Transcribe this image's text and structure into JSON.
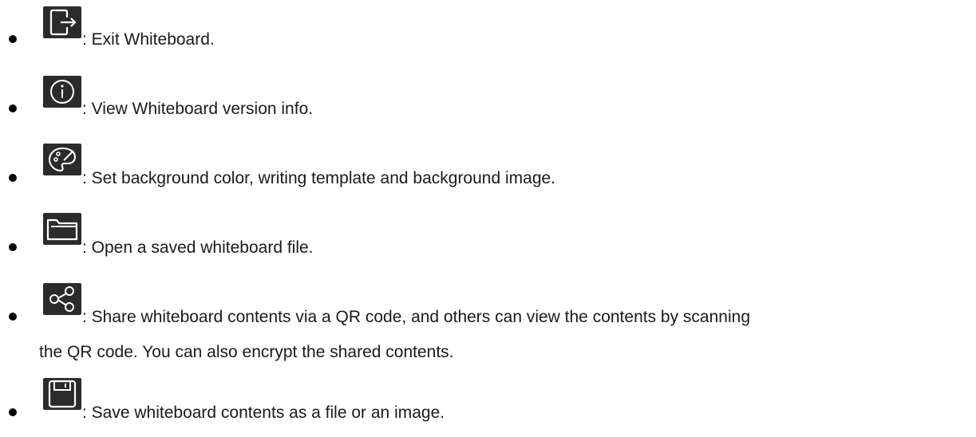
{
  "items": [
    {
      "icon": "exit-icon",
      "text": ": Exit Whiteboard."
    },
    {
      "icon": "info-icon",
      "text": ": View Whiteboard version info."
    },
    {
      "icon": "palette-icon",
      "text": ": Set background color, writing template and background image."
    },
    {
      "icon": "folder-icon",
      "text": ": Open a saved whiteboard file."
    },
    {
      "icon": "share-icon",
      "text": ": Share whiteboard contents via a QR code, and others can view the contents by scanning",
      "continuation": "the QR code. You can also encrypt the shared contents."
    },
    {
      "icon": "save-icon",
      "text": ": Save whiteboard contents as a file or an image."
    }
  ]
}
